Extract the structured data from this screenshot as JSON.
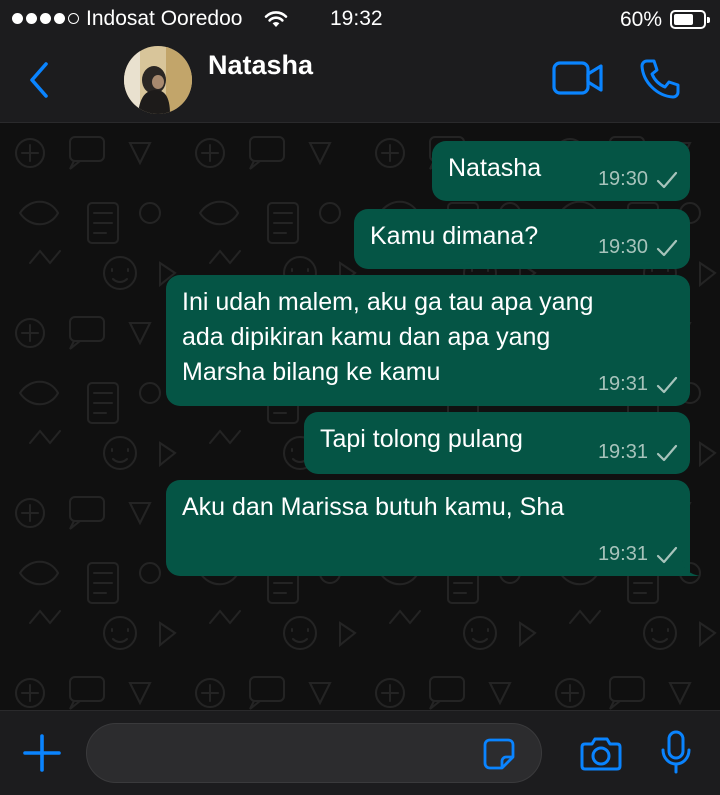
{
  "status_bar": {
    "carrier": "Indosat Ooredoo",
    "time": "19:32",
    "battery_percent": "60%",
    "signal_bars_filled": 4,
    "signal_bars_total": 5,
    "battery_level": 0.6
  },
  "header": {
    "contact_name": "Natasha",
    "icons": [
      "back-chevron-icon",
      "video-call-icon",
      "phone-call-icon"
    ]
  },
  "messages": [
    {
      "text": "Natasha",
      "time": "19:30",
      "status": "sent"
    },
    {
      "text": "Kamu dimana?",
      "time": "19:30",
      "status": "sent"
    },
    {
      "text": "Ini udah malem, aku ga tau apa yang\nada dipikiran kamu dan apa yang\nMarsha bilang ke kamu",
      "time": "19:31",
      "status": "sent"
    },
    {
      "text": "Tapi tolong pulang",
      "time": "19:31",
      "status": "sent"
    },
    {
      "text": "Aku dan Marissa butuh kamu, Sha",
      "time": "19:31",
      "status": "sent"
    }
  ],
  "input_bar": {
    "message_value": "",
    "icons": [
      "plus-icon",
      "sticker-icon",
      "camera-icon",
      "microphone-icon"
    ]
  },
  "colors": {
    "accent": "#0a84ff",
    "outgoing_bubble": "#055545",
    "bar_background": "#1c1c1e",
    "chat_background": "#101010"
  }
}
